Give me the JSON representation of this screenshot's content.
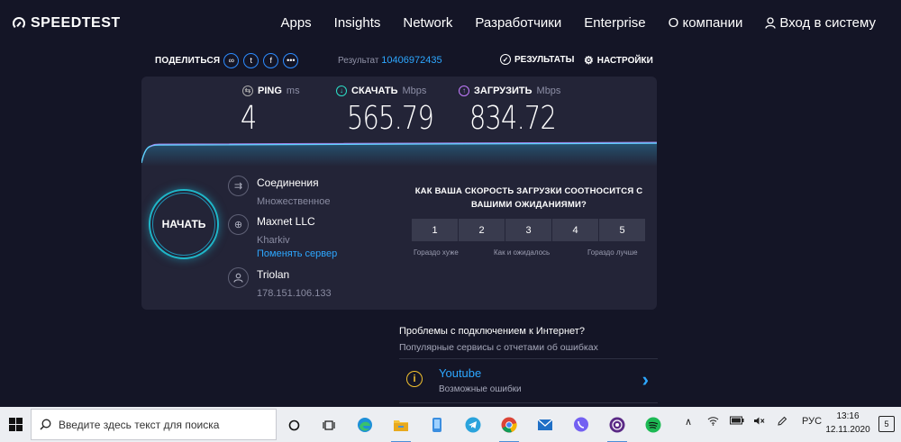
{
  "header": {
    "logo": "SPEEDTEST",
    "nav": [
      "Apps",
      "Insights",
      "Network",
      "Разработчики",
      "Enterprise",
      "О компании"
    ],
    "login": "Вход в систему"
  },
  "share": {
    "label": "ПОДЕЛИТЬСЯ",
    "icons": [
      "link-icon",
      "twitter-icon",
      "facebook-icon",
      "more-icon"
    ],
    "result_label": "Результат",
    "result_id": "10406972435",
    "results_button": "РЕЗУЛЬТАТЫ",
    "settings_button": "НАСТРОЙКИ"
  },
  "metrics": {
    "ping": {
      "label": "PING",
      "unit": "ms",
      "value": "4"
    },
    "download": {
      "label": "СКАЧАТЬ",
      "unit": "Mbps",
      "value": "565.79"
    },
    "upload": {
      "label": "ЗАГРУЗИТЬ",
      "unit": "Mbps",
      "value": "834.72"
    }
  },
  "go_button": "НАЧАТЬ",
  "connection": {
    "title": "Соединения",
    "mode": "Множественное",
    "server_name": "Maxnet LLC",
    "server_city": "Kharkiv",
    "change_server": "Поменять сервер",
    "provider": "Triolan",
    "ip": "178.151.106.133"
  },
  "survey": {
    "question": "КАК ВАША СКОРОСТЬ ЗАГРУЗКИ СООТНОСИТСЯ С ВАШИМИ ОЖИДАНИЯМИ?",
    "options": [
      "1",
      "2",
      "3",
      "4",
      "5"
    ],
    "label_low": "Гораздо хуже",
    "label_mid": "Как и ожидалось",
    "label_high": "Гораздо лучше"
  },
  "problems": {
    "title": "Проблемы с подключением к Интернет?",
    "subtitle": "Популярные сервисы с отчетами об ошибках",
    "service_name": "Youtube",
    "service_desc": "Возможные ошибки"
  },
  "taskbar": {
    "search_placeholder": "Введите здесь текст для поиска",
    "apps": [
      "cortana-icon",
      "task-view-icon",
      "edge-icon",
      "file-explorer-icon",
      "phone-icon",
      "telegram-icon",
      "chrome-icon",
      "mail-icon",
      "viber-icon",
      "podcast-icon",
      "spotify-icon"
    ],
    "language": "РУС",
    "time": "13:16",
    "date": "12.11.2020",
    "notification_count": "5"
  },
  "colors": {
    "background": "#141526",
    "card": "#232437",
    "accent_blue": "#2da7ff",
    "download": "#2de0c8",
    "upload": "#c37cff",
    "go_ring": "#1fb7c9"
  }
}
